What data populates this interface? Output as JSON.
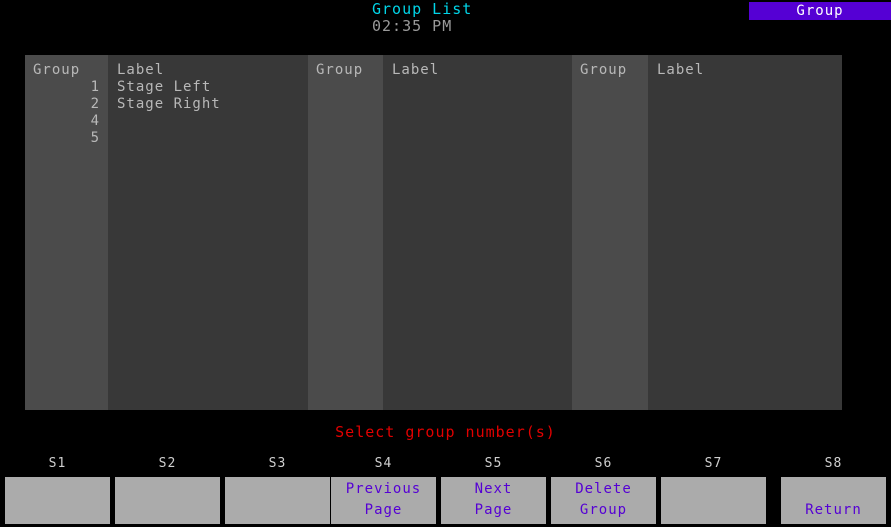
{
  "header": {
    "title": "Group List",
    "clock": "02:35 PM",
    "mode_badge": "Group",
    "title_color": "#00d5e8",
    "clock_color": "#9a9a9a",
    "badge_bg": "#5500d4",
    "badge_fg": "#ffffff"
  },
  "panel": {
    "columns": [
      {
        "num_header": "Group",
        "label_header": "Label",
        "numbers": [
          "1",
          "2",
          "4",
          "5"
        ],
        "labels": [
          "Stage Left",
          "Stage Right",
          "",
          ""
        ]
      },
      {
        "num_header": "Group",
        "label_header": "Label",
        "numbers": [],
        "labels": []
      },
      {
        "num_header": "Group",
        "label_header": "Label",
        "numbers": [],
        "labels": []
      }
    ],
    "bg": "#333333",
    "num_col_bg": "#4b4b4b",
    "label_col_bg": "#383838",
    "text_color": "#b8b8b8"
  },
  "prompt": {
    "text": "Select group number(s)",
    "color": "#e00000"
  },
  "softkeys": [
    {
      "id": "S1",
      "line1": "",
      "line2": "",
      "align": "top"
    },
    {
      "id": "S2",
      "line1": "",
      "line2": "",
      "align": "top"
    },
    {
      "id": "S3",
      "line1": "",
      "line2": "",
      "align": "top"
    },
    {
      "id": "S4",
      "line1": "Previous",
      "line2": "Page",
      "align": "top"
    },
    {
      "id": "S5",
      "line1": "Next",
      "line2": "Page",
      "align": "top"
    },
    {
      "id": "S6",
      "line1": "Delete",
      "line2": "Group",
      "align": "top"
    },
    {
      "id": "S7",
      "line1": "",
      "line2": "",
      "align": "top"
    },
    {
      "id": "S8",
      "line1": "Return",
      "line2": "",
      "align": "bottom"
    }
  ],
  "softkey_style": {
    "button_bg": "#ababab",
    "label_color": "#5500d4",
    "id_color": "#d0d0d0"
  }
}
